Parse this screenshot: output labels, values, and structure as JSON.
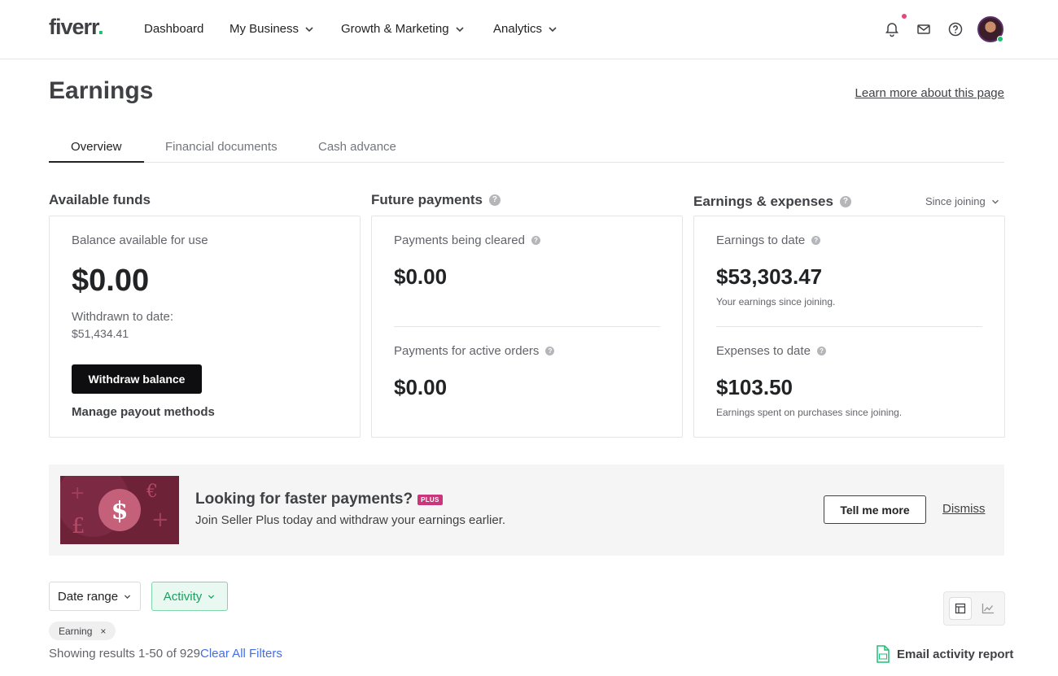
{
  "header": {
    "logo": "fiverr",
    "logo_dot": ".",
    "nav": [
      {
        "label": "Dashboard"
      },
      {
        "label": "My Business"
      },
      {
        "label": "Growth & Marketing"
      },
      {
        "label": "Analytics"
      }
    ]
  },
  "page": {
    "title": "Earnings",
    "learn_more": "Learn more about this page"
  },
  "tabs": [
    {
      "label": "Overview",
      "active": true
    },
    {
      "label": "Financial documents"
    },
    {
      "label": "Cash advance"
    }
  ],
  "available_funds": {
    "title": "Available funds",
    "balance_label": "Balance available for use",
    "balance": "$0.00",
    "withdrawn_label": "Withdrawn to date:",
    "withdrawn_value": "$51,434.41",
    "withdraw_button": "Withdraw balance",
    "manage_link": "Manage payout methods"
  },
  "future_payments": {
    "title": "Future payments",
    "cleared_label": "Payments being cleared",
    "cleared_value": "$0.00",
    "active_label": "Payments for active orders",
    "active_value": "$0.00"
  },
  "earnings_expenses": {
    "title": "Earnings & expenses",
    "period": "Since joining",
    "earnings_label": "Earnings to date",
    "earnings_value": "$53,303.47",
    "earnings_sub": "Your earnings since joining.",
    "expenses_label": "Expenses to date",
    "expenses_value": "$103.50",
    "expenses_sub": "Earnings spent on purchases since joining."
  },
  "promo": {
    "title": "Looking for faster payments?",
    "badge": "PLUS",
    "subtitle": "Join Seller Plus today and withdraw your earnings earlier.",
    "cta": "Tell me more",
    "dismiss": "Dismiss",
    "image_symbols": {
      "dollar": "$",
      "pound": "£",
      "euro": "€",
      "plus": "+"
    }
  },
  "filters": {
    "date_range": "Date range",
    "activity": "Activity",
    "chip": "Earning",
    "chip_remove": "×",
    "results": "Showing results 1-50 of 929",
    "clear_all": "Clear All Filters",
    "email_report": "Email activity report"
  },
  "colors": {
    "brand_green": "#1dbf73",
    "link_blue": "#446ee7",
    "promo_maroon": "#6e2237",
    "plus_pink": "#c9367b"
  }
}
